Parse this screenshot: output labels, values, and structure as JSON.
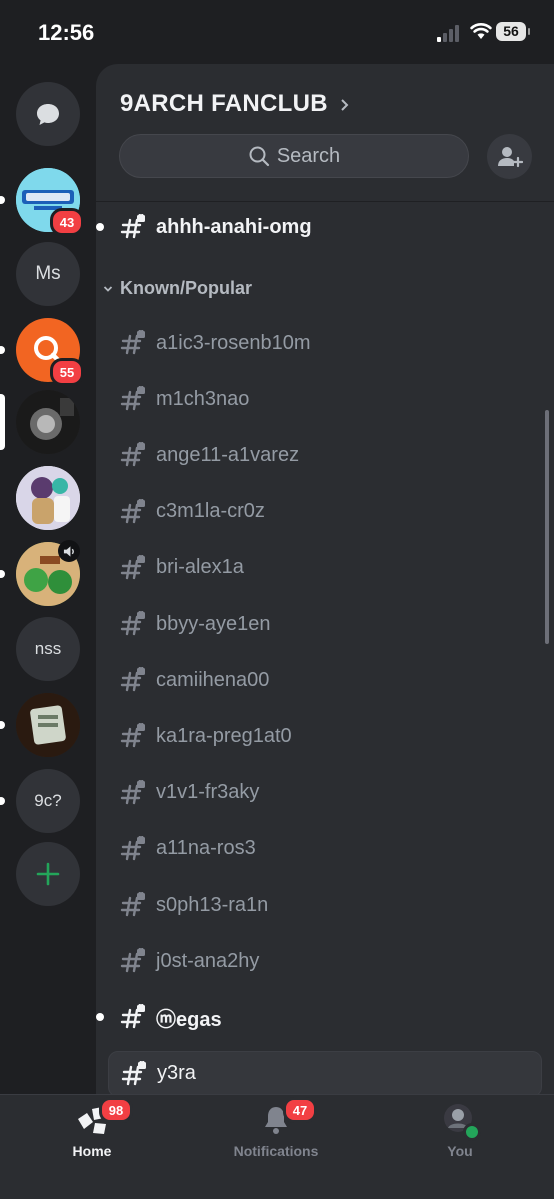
{
  "status_bar": {
    "time": "12:56",
    "battery": "56"
  },
  "servers": [
    {
      "id": "dm",
      "icon": "chat-bubble-icon"
    },
    {
      "id": "server-1",
      "badge": "43",
      "unread": true
    },
    {
      "id": "server-2",
      "label": "Ms"
    },
    {
      "id": "server-3",
      "badge": "55",
      "unread": true
    },
    {
      "id": "server-4",
      "selected": true
    },
    {
      "id": "server-5"
    },
    {
      "id": "server-6",
      "unread": true,
      "icon": "speaker-icon"
    },
    {
      "id": "server-7",
      "label": "nss"
    },
    {
      "id": "server-8",
      "unread": true
    },
    {
      "id": "server-9",
      "label": "9c?",
      "unread": true
    },
    {
      "id": "add",
      "icon": "plus-icon"
    }
  ],
  "server": {
    "name": "9ARCH FANCLUB"
  },
  "search": {
    "label": "Search"
  },
  "channels_top": [
    {
      "name": "ahhh-anahi-omg",
      "unread": true,
      "locked": true
    }
  ],
  "category": {
    "name": "Known/Popular"
  },
  "channels": [
    {
      "name": "a1ic3-rosenb10m",
      "locked": true
    },
    {
      "name": "m1ch3nao",
      "locked": true
    },
    {
      "name": "ange11-a1varez",
      "locked": true
    },
    {
      "name": "c3m1la-cr0z",
      "locked": true
    },
    {
      "name": "bri-alex1a",
      "locked": true
    },
    {
      "name": "bbyy-aye1en",
      "locked": true
    },
    {
      "name": "camiihena00",
      "locked": true
    },
    {
      "name": "ka1ra-preg1at0",
      "locked": true
    },
    {
      "name": "v1v1-fr3aky",
      "locked": true
    },
    {
      "name": "a11na-ros3",
      "locked": true
    },
    {
      "name": "s0ph13-ra1n",
      "locked": true
    },
    {
      "name": "j0st-ana2hy",
      "locked": true
    },
    {
      "name": "ⓜegas",
      "unread": true,
      "locked": true
    },
    {
      "name": "y3ra",
      "active": true,
      "locked": true
    }
  ],
  "tabs": {
    "home": {
      "label": "Home",
      "badge": "98"
    },
    "notifications": {
      "label": "Notifications",
      "badge": "47"
    },
    "you": {
      "label": "You"
    }
  },
  "colors": {
    "accent_red": "#f23f43",
    "online_green": "#23a55a",
    "add_green": "#23a55a",
    "bg": "#1e1f22",
    "panel": "#2b2d31"
  }
}
